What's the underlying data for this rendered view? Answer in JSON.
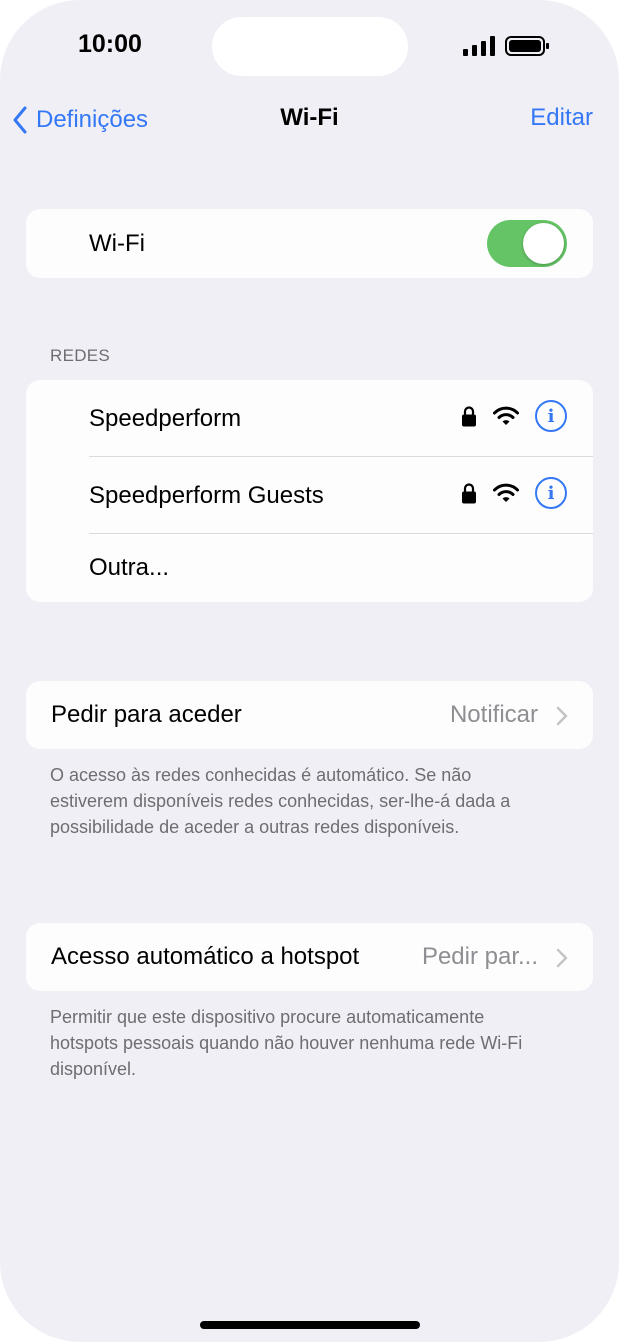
{
  "status_bar": {
    "time": "10:00"
  },
  "nav": {
    "back_label": "Definições",
    "title": "Wi-Fi",
    "edit_label": "Editar"
  },
  "wifi_toggle": {
    "label": "Wi-Fi",
    "on": true
  },
  "networks": {
    "header": "REDES",
    "items": [
      {
        "name": "Speedperform"
      },
      {
        "name": "Speedperform Guests"
      },
      {
        "name": "Outra..."
      }
    ]
  },
  "ask_to_join": {
    "label": "Pedir para aceder",
    "value": "Notificar",
    "footnote": "O acesso às redes conhecidas é automático. Se não estiverem disponíveis redes conhecidas, ser-lhe-á dada a possibilidade de aceder a outras redes disponíveis."
  },
  "auto_hotspot": {
    "label": "Acesso automático a hotspot",
    "value": "Pedir par...",
    "footnote": "Permitir que este dispositivo procure automaticamente hotspots pessoais quando não houver nenhuma rede Wi-Fi disponível."
  },
  "colors": {
    "accent": "#3478f6",
    "toggle_on": "#65c466",
    "background": "#f0eff5"
  }
}
